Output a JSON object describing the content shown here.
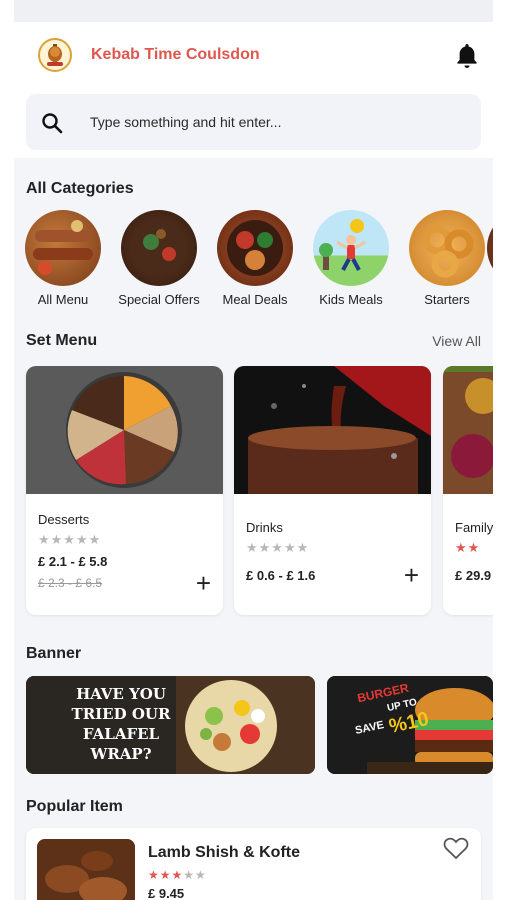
{
  "header": {
    "brand": "Kebab Time Coulsdon"
  },
  "search": {
    "placeholder": "Type something and hit enter..."
  },
  "categories": {
    "title": "All Categories",
    "items": [
      {
        "label": "All Menu"
      },
      {
        "label": "Special Offers"
      },
      {
        "label": "Meal Deals"
      },
      {
        "label": "Kids Meals"
      },
      {
        "label": "Starters"
      }
    ]
  },
  "set_menu": {
    "title": "Set Menu",
    "view_all": "View All",
    "items": [
      {
        "name": "Desserts",
        "stars": "★★★★★",
        "price": "£ 2.1 - £ 5.8",
        "old_price": "£ 2.3 - £ 6.5"
      },
      {
        "name": "Drinks",
        "stars": "★★★★★",
        "price": "£ 0.6 - £ 1.6"
      },
      {
        "name": "Family",
        "stars": "★★",
        "price": "£ 29.9"
      }
    ]
  },
  "banner": {
    "title": "Banner",
    "banner1_text": "HAVE YOU TRIED OUR FALAFEL WRAP?",
    "banner2_burger": "BURGER",
    "banner2_upto": "UP TO",
    "banner2_save": "SAVE",
    "banner2_amount": "%10"
  },
  "popular": {
    "title": "Popular Item",
    "item": {
      "name": "Lamb Shish & Kofte",
      "stars_filled": "★★★",
      "stars_empty": "★★",
      "price": "£ 9.45"
    }
  },
  "colors": {
    "brand": "#e0574f",
    "star_filled": "#e0574f",
    "star_empty": "#b7b7b7",
    "background": "#f4f5f8"
  }
}
